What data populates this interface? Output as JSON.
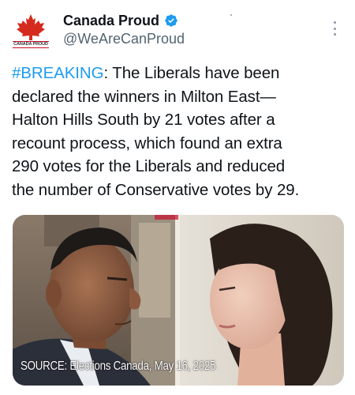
{
  "account": {
    "display_name": "Canada Proud",
    "handle": "@WeAreCanProud",
    "avatar_text": "CANADA PROUD",
    "verified": true
  },
  "tweet": {
    "hashtag": "#BREAKING",
    "lines": [
      ": The Liberals have been",
      "declared the winners in Milton East—",
      "Halton Hills South by 21 votes after a",
      "recount process, which found an extra",
      "290 votes for the Liberals and reduced",
      "the number of Conservative votes by 29."
    ]
  },
  "media": {
    "caption": "SOURCE: Elections Canada, May 16, 2025"
  },
  "colors": {
    "text": "#0f1419",
    "secondary": "#536471",
    "link": "#1d9bf0",
    "verified": "#1d9bf0",
    "brand_red": "#c8102e"
  },
  "icons": {
    "verified": "verified-badge-icon",
    "more": "more-options-icon"
  }
}
